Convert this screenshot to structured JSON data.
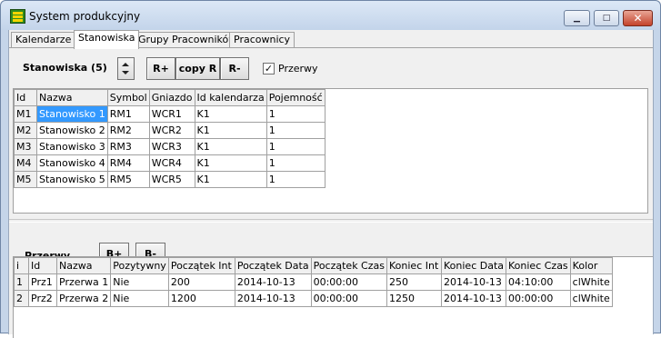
{
  "window": {
    "title": "System produkcyjny",
    "buttons": {
      "minimize": "▁",
      "maximize": "□",
      "close": "✕"
    }
  },
  "tabs": [
    {
      "label": "Kalendarze",
      "active": false
    },
    {
      "label": "Stanowiska",
      "active": true
    },
    {
      "label": "Grupy Pracowników",
      "active": false
    },
    {
      "label": "Pracownicy",
      "active": false
    }
  ],
  "stations": {
    "heading": "Stanowiska (5)",
    "buttons": {
      "add": "R+",
      "copy": "copy R",
      "remove": "R-"
    },
    "breaks_checkbox": {
      "label": "Przerwy",
      "checked": true,
      "mark": "✓"
    },
    "columns": [
      "Id",
      "Nazwa",
      "Symbol",
      "Gniazdo",
      "Id kalendarza",
      "Pojemność"
    ],
    "rows": [
      [
        "M1",
        "Stanowisko 1",
        "RM1",
        "WCR1",
        "K1",
        "1"
      ],
      [
        "M2",
        "Stanowisko 2",
        "RM2",
        "WCR2",
        "K1",
        "1"
      ],
      [
        "M3",
        "Stanowisko 3",
        "RM3",
        "WCR3",
        "K1",
        "1"
      ],
      [
        "M4",
        "Stanowisko 4",
        "RM4",
        "WCR4",
        "K1",
        "1"
      ],
      [
        "M5",
        "Stanowisko 5",
        "RM5",
        "WCR5",
        "K1",
        "1"
      ]
    ],
    "selected_row": 0
  },
  "breaks": {
    "heading": "Przerwy",
    "buttons": {
      "add": "B+",
      "remove": "B-"
    },
    "columns": [
      "i",
      "Id",
      "Nazwa",
      "Pozytywny",
      "Początek Int",
      "Początek Data",
      "Początek Czas",
      "Koniec Int",
      "Koniec Data",
      "Koniec Czas",
      "Kolor"
    ],
    "rows": [
      [
        "1",
        "Prz1",
        "Przerwa 1",
        "Nie",
        "200",
        "2014-10-13",
        "00:00:00",
        "250",
        "2014-10-13",
        "04:10:00",
        "clWhite"
      ],
      [
        "2",
        "Prz2",
        "Przerwa 2",
        "Nie",
        "1200",
        "2014-10-13",
        "00:00:00",
        "1250",
        "2014-10-13",
        "00:00:00",
        "clWhite"
      ]
    ]
  }
}
